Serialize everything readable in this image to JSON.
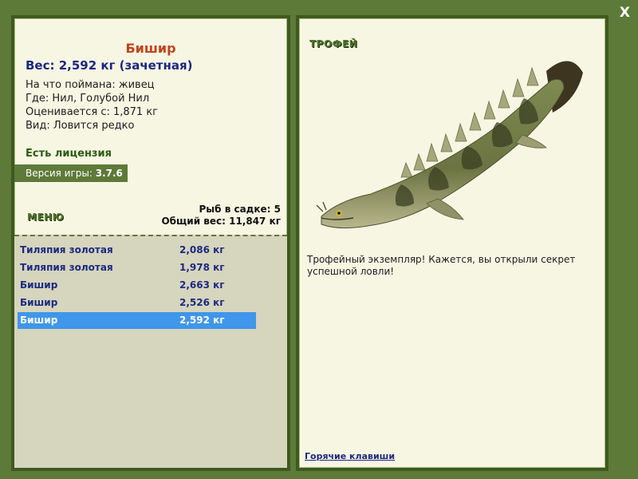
{
  "close": {
    "label": "X"
  },
  "fish": {
    "name": "Бишир",
    "weight_line": "Вес: 2,592 кг (зачетная)",
    "details": [
      "На что поймана: живец",
      "Где: Нил, Голубой Нил",
      "Оценивается с: 1,871 кг",
      "Вид: Ловится редко"
    ]
  },
  "license": "Есть лицензия",
  "version": {
    "label": "Версия игры:",
    "value": "3.7.6"
  },
  "menu_label": "МЕНЮ",
  "cage": {
    "count_line": "Рыб в садке: 5",
    "total_line": "Общий вес: 11,847 кг"
  },
  "catches": [
    {
      "name": "Тиляпия золотая",
      "weight": "2,086 кг"
    },
    {
      "name": "Тиляпия золотая",
      "weight": "1,978 кг"
    },
    {
      "name": "Бишир",
      "weight": "2,663 кг"
    },
    {
      "name": "Бишир",
      "weight": "2,526 кг"
    },
    {
      "name": "Бишир",
      "weight": "2,592 кг",
      "selected": true
    }
  ],
  "trophy": {
    "label": "ТРОФЕЙ",
    "text": "Трофейный экземпляр! Кажется, вы открыли секрет успешной ловли!"
  },
  "hotkeys": "Горячие клавиши",
  "colors": {
    "background": "#5d7a39",
    "panel": "#f7f6e3",
    "list_bg": "#d6d5bd",
    "selected_row": "#3f96ea",
    "fish_name": "#c0441b",
    "weight_text": "#1a2783"
  }
}
